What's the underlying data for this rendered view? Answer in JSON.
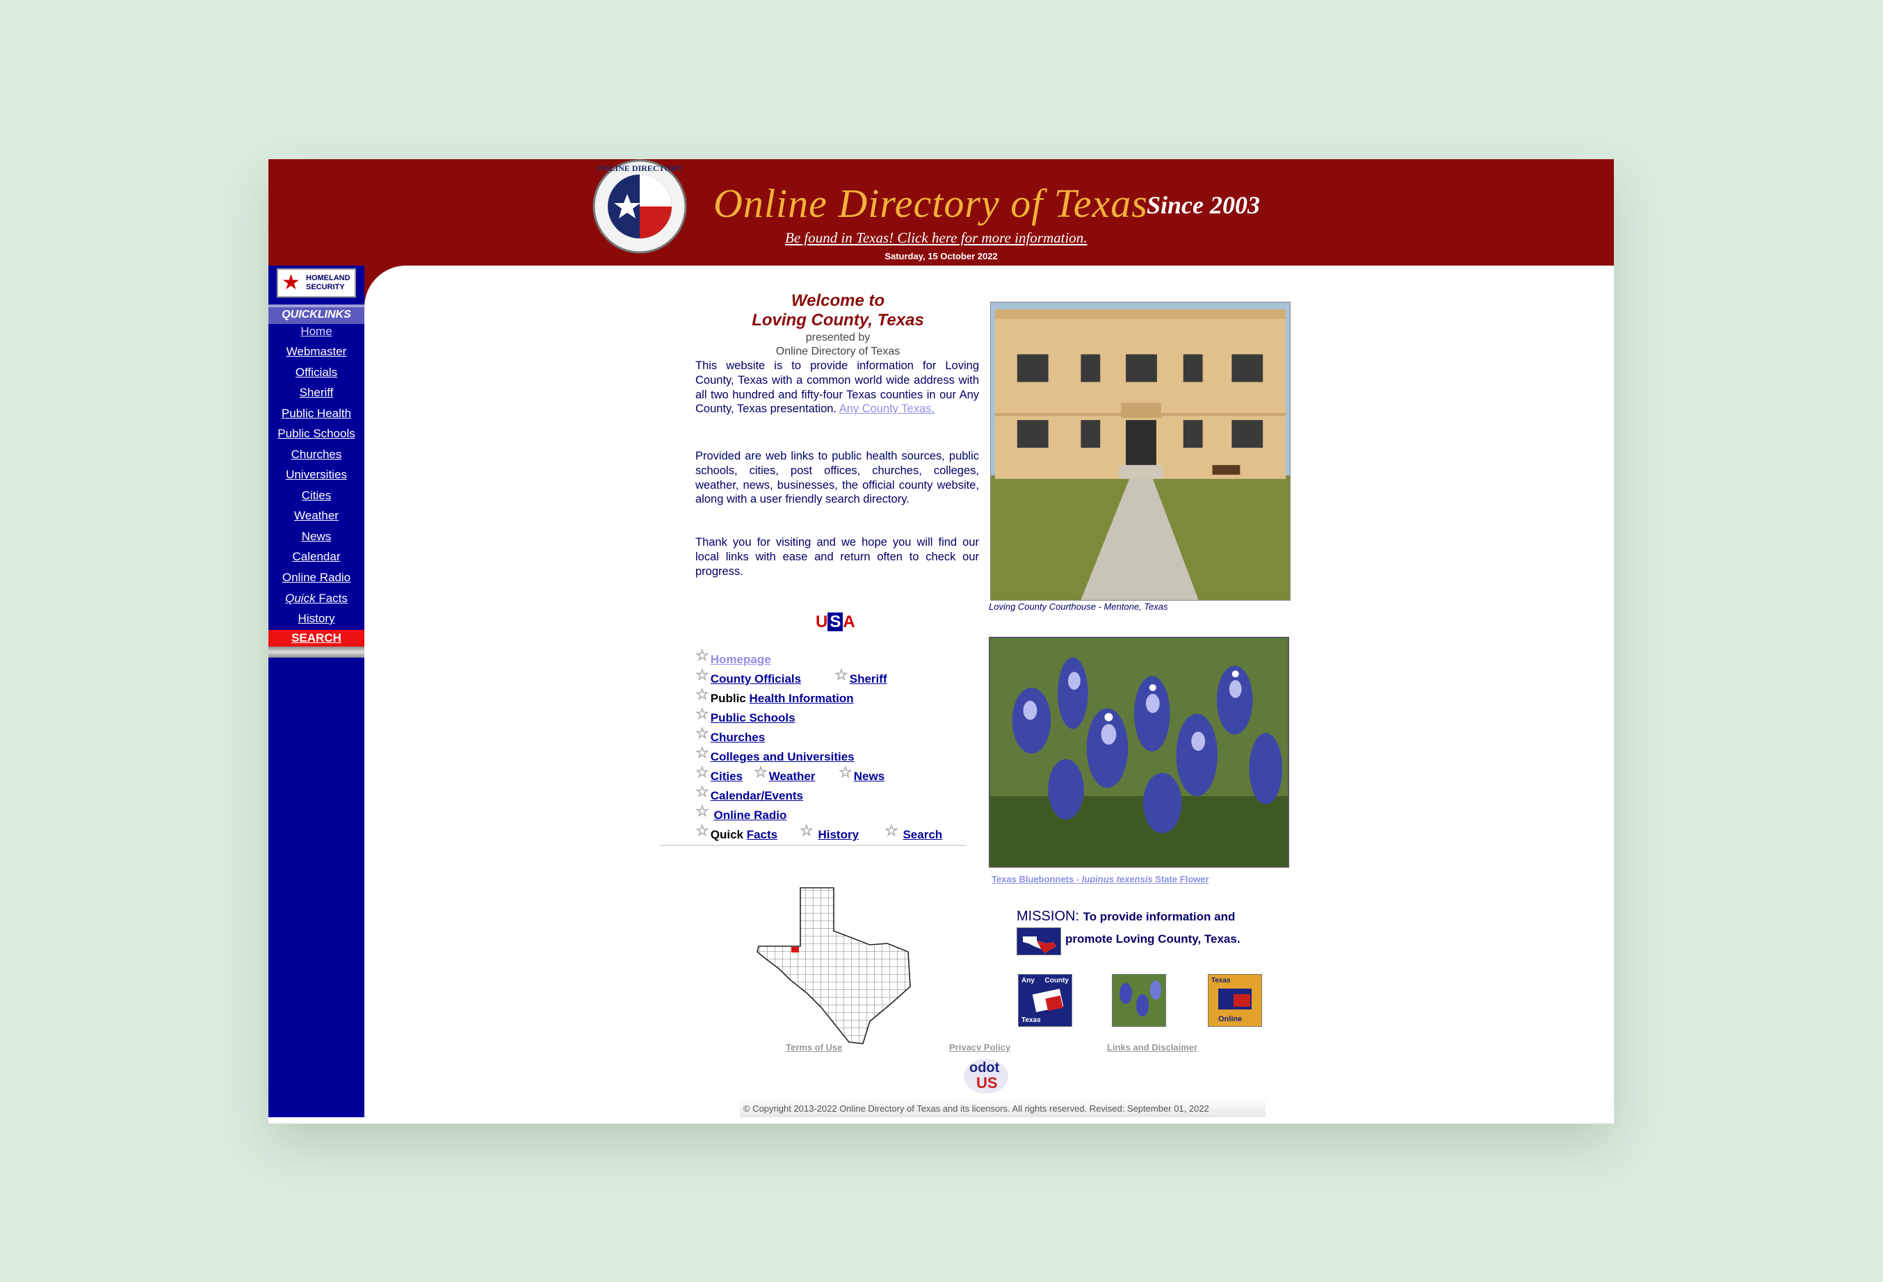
{
  "banner": {
    "seal_text": "ONLINE DIRECTORY",
    "title": "Online Directory of Texas",
    "since": "Since 2003",
    "promo_link": "Be found in Texas!  Click here for more information.",
    "date": "Saturday, 15 October 2022"
  },
  "sidebar": {
    "homeland_badge": "HOMELAND SECURITY",
    "quicklinks_header": "QUICKLINKS",
    "items": [
      {
        "label": "Home"
      },
      {
        "label": "Webmaster"
      },
      {
        "label": "Officials"
      },
      {
        "label": "Sheriff"
      },
      {
        "label": "Public Health"
      },
      {
        "label": "Public Schools"
      },
      {
        "label": "Churches"
      },
      {
        "label": "Universities"
      },
      {
        "label": "Cities"
      },
      {
        "label": "Weather"
      },
      {
        "label": "News"
      },
      {
        "label": "Calendar"
      },
      {
        "label": "Online Radio"
      },
      {
        "label_italic": "Quick",
        "label": "Facts"
      },
      {
        "label": "History"
      }
    ],
    "search": "SEARCH"
  },
  "welcome": {
    "line1": "Welcome to",
    "line2": "Loving County, Texas",
    "presented_by": "presented by",
    "presenter": "Online Directory of Texas",
    "para1_text": "This website is to provide information for Loving County, Texas with a common world wide address with all two hundred and fifty-four Texas counties in our Any County, Texas presentation.",
    "para1_link": "Any County Texas.",
    "para2": "Provided are web links to public health sources, public schools, cities, post offices, churches, colleges, weather, news, businesses, the official county website, along with a user friendly search directory.",
    "para3": "Thank you for visiting and we hope you will find our local links with ease and return often to check our progress."
  },
  "usa": {
    "u": "U",
    "s": "S",
    "a": "A"
  },
  "nav_links": {
    "homepage": "Homepage",
    "county_officials": "County Officials",
    "sheriff": "Sheriff",
    "public_prefix": "Public",
    "health_information": "Health Information",
    "public_schools": "Public Schools",
    "churches": "Churches",
    "colleges": "Colleges and Universities",
    "cities": "Cities",
    "weather": "Weather",
    "news": "News",
    "calendar_events": "Calendar/Events",
    "online_radio": "Online Radio",
    "quick_prefix": "Quick",
    "facts": "Facts",
    "history": "History",
    "search": "Search"
  },
  "photos": {
    "courthouse_caption": "Loving County Courthouse - Mentone, Texas",
    "bluebonnet_caption_a": "Texas Bluebonnets - ",
    "bluebonnet_caption_b": "lupinus texensis",
    "bluebonnet_caption_c": "  State Flower"
  },
  "mission": {
    "label": "MISSION:",
    "line1": "To provide information and",
    "line2": "promote Loving County, Texas."
  },
  "badges": {
    "any_county_top": "Any",
    "any_county_mid": "County",
    "any_county_bottom": "Texas",
    "texas_online_top": "Texas",
    "texas_online_bottom": "Online"
  },
  "footer": {
    "terms": "Terms of Use",
    "privacy": "Privacy Policy",
    "links": "Links and Disclaimer",
    "odot_top": "odot",
    "odot_bottom": "US",
    "copyright": "© Copyright 2013-2022 Online Directory of  Texas and its licensors. All rights reserved.  Revised: September 01, 2022"
  },
  "colors": {
    "banner": "#8a0a0a",
    "sidebar": "#000099",
    "title_gold": "#f3b23a",
    "link": "#000099",
    "visited_link": "#8f8fe6",
    "search_red": "#ee1111"
  }
}
